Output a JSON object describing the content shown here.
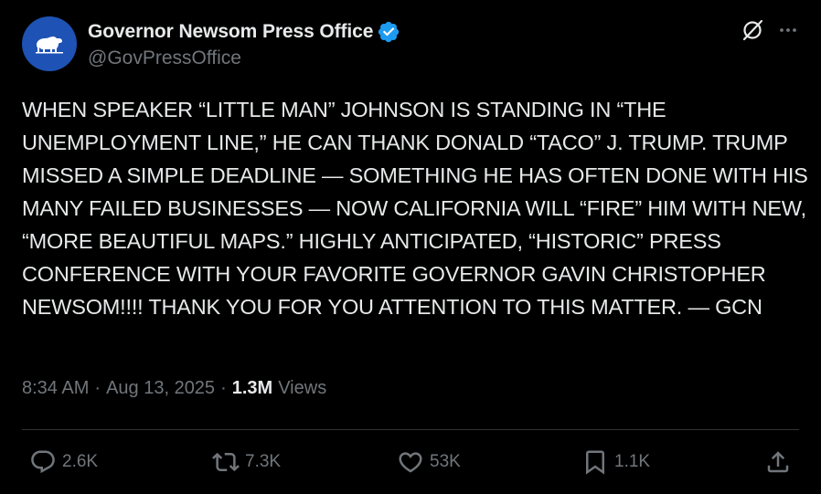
{
  "account": {
    "display_name": "Governor Newsom Press Office",
    "handle": "@GovPressOffice"
  },
  "post": {
    "text": "WHEN SPEAKER “LITTLE MAN” JOHNSON IS STANDING IN “THE UNEMPLOYMENT LINE,” HE CAN THANK DONALD “TACO” J. TRUMP. TRUMP MISSED A SIMPLE DEADLINE — SOMETHING HE HAS OFTEN DONE WITH HIS MANY FAILED BUSINESSES — NOW CALIFORNIA WILL “FIRE” HIM WITH NEW, “MORE BEAUTIFUL MAPS.” HIGHLY ANTICIPATED, “HISTORIC” PRESS CONFERENCE WITH YOUR FAVORITE GOVERNOR GAVIN CHRISTOPHER NEWSOM!!!! THANK YOU FOR YOU ATTENTION TO THIS MATTER. — GCN",
    "time": "8:34 AM",
    "date": "Aug 13, 2025",
    "separator": "·",
    "views_count": "1.3M",
    "views_label": "Views"
  },
  "actions": {
    "replies": "2.6K",
    "reposts": "7.3K",
    "likes": "53K",
    "bookmarks": "1.1K"
  },
  "icons": {
    "avatar": "california-bear-icon",
    "verified": "verified-badge-icon",
    "grok": "grok-icon",
    "more": "more-options-icon",
    "reply": "reply-icon",
    "repost": "repost-icon",
    "like": "heart-icon",
    "bookmark": "bookmark-icon",
    "share": "share-icon"
  },
  "colors": {
    "background": "#000000",
    "text": "#e7e9ea",
    "muted": "#71767b",
    "verified": "#1d9bf0",
    "avatar_bg": "#1e52b4"
  }
}
